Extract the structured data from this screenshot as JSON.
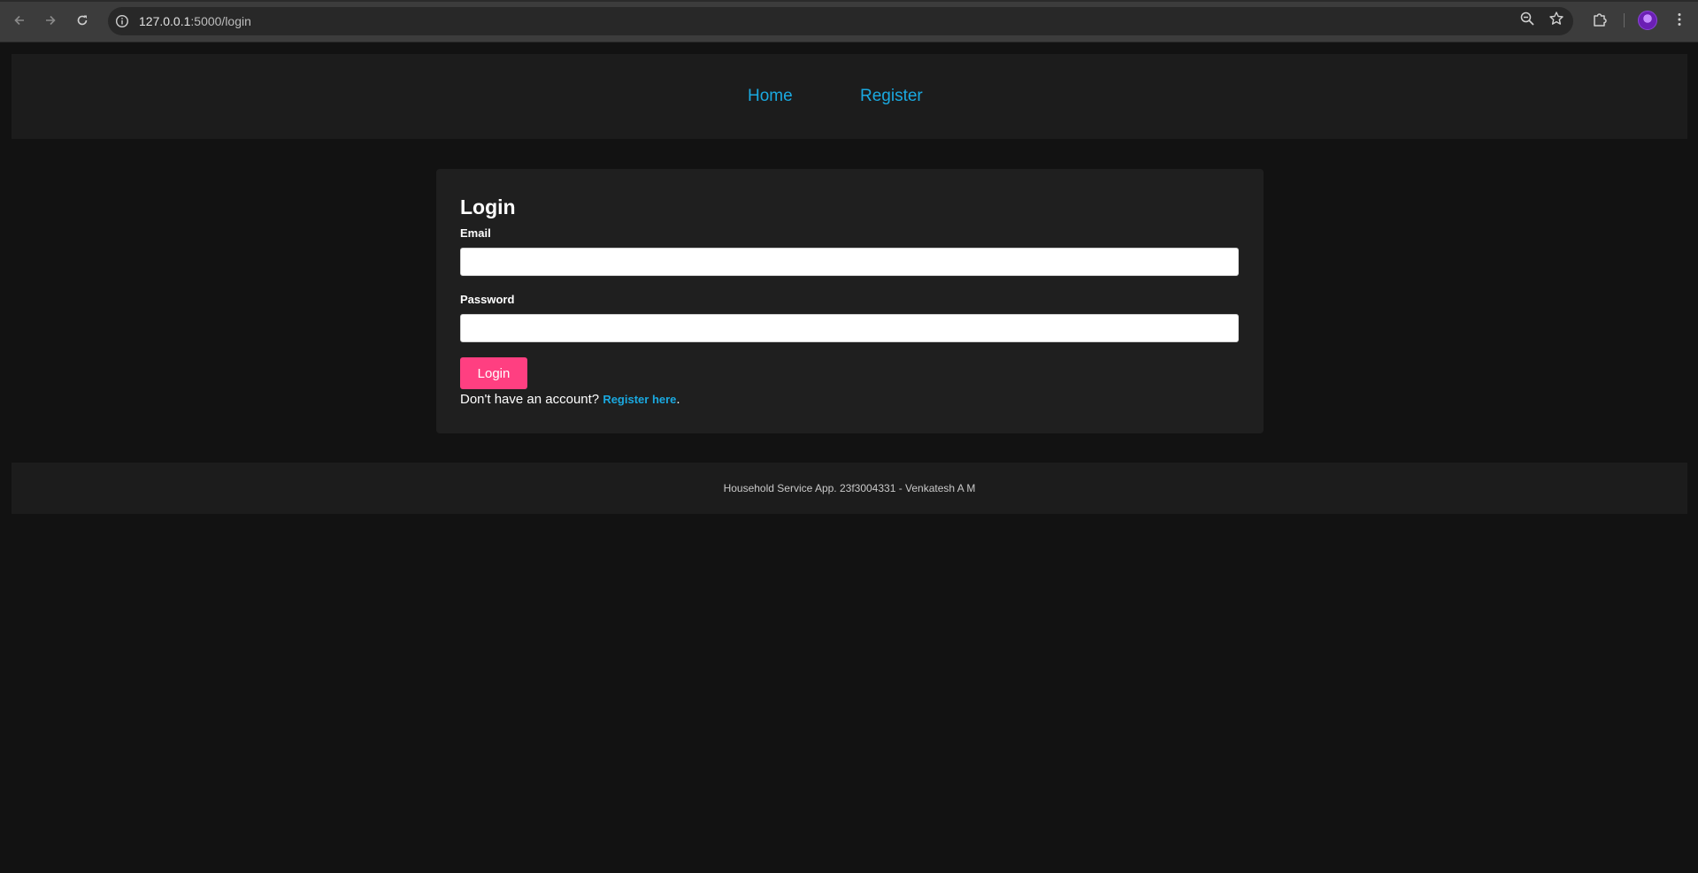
{
  "browser": {
    "url_host": "127.0.0.1",
    "url_path": ":5000/login",
    "icons": {
      "back": "back-arrow-icon",
      "forward": "forward-arrow-icon",
      "reload": "reload-icon",
      "info": "info-icon",
      "zoom": "zoom-out-icon",
      "bookmark": "star-icon",
      "extensions": "puzzle-icon",
      "menu": "kebab-menu-icon"
    }
  },
  "nav": {
    "home": "Home",
    "register": "Register"
  },
  "login": {
    "title": "Login",
    "email_label": "Email",
    "email_value": "",
    "password_label": "Password",
    "password_value": "",
    "submit_label": "Login",
    "prompt_text": "Don't have an account? ",
    "register_link": "Register here",
    "period": "."
  },
  "footer": {
    "text": "Household Service App. 23f3004331 - Venkatesh A M"
  },
  "colors": {
    "background": "#121212",
    "panel": "#1c1c1c",
    "card": "#1f1f1f",
    "link": "#1aa9e0",
    "button": "#ff3f81"
  }
}
